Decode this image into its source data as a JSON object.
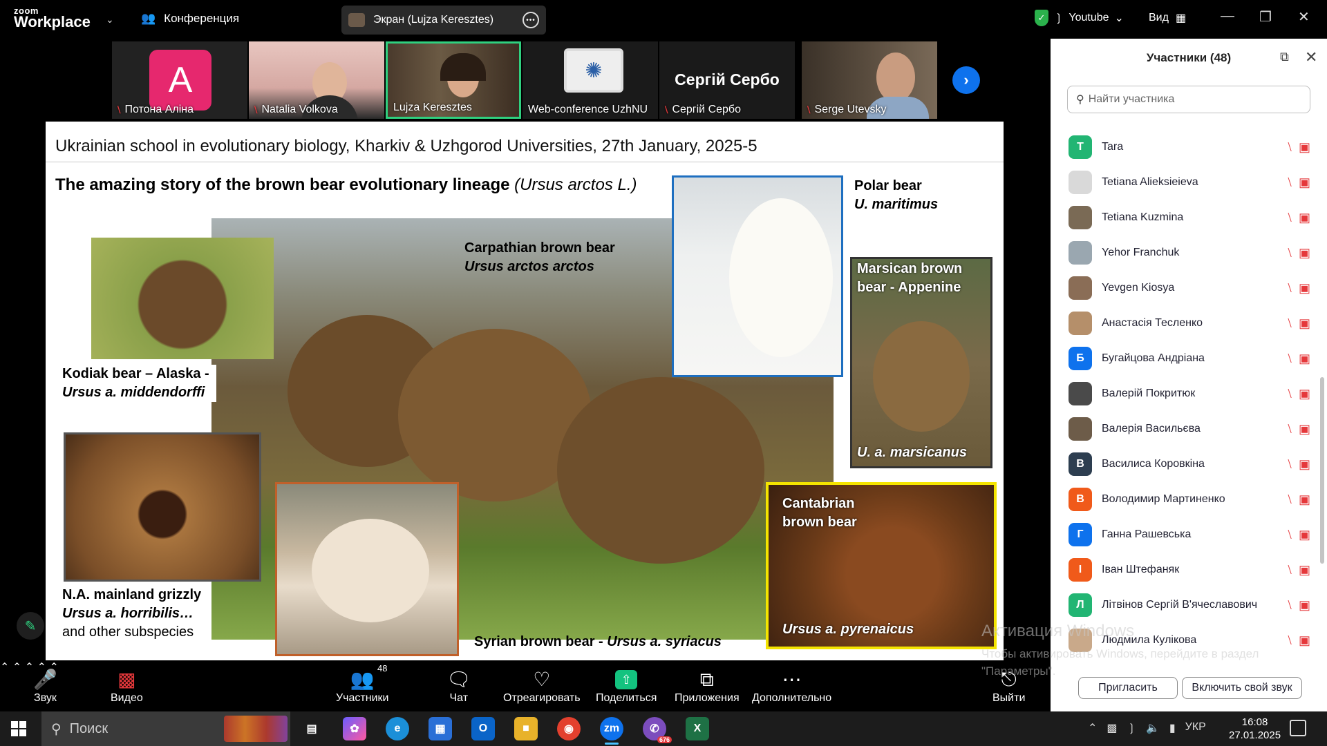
{
  "topbar": {
    "logo_line1": "zoom",
    "logo_line2": "Workplace",
    "conference_label": "Конференция",
    "screen_share_label": "Экран (Lujza Keresztes)",
    "stream_label": "Youtube",
    "view_label": "Вид"
  },
  "thumbnails": [
    {
      "name": "Потона Аліна",
      "initial": "A",
      "color": "#e6286e"
    },
    {
      "name": "Natalia Volkova"
    },
    {
      "name": "Lujza Keresztes"
    },
    {
      "name": "Web-conference UzhNU"
    },
    {
      "name": "Сергій Сербо",
      "display": "Сергій Сербо"
    },
    {
      "name": "Serge Utevsky"
    }
  ],
  "slide": {
    "header": "Ukrainian school in evolutionary biology, Kharkiv & Uzhgorod Universities, 27th January, 2025-5",
    "title_main": "The amazing story of the brown bear evolutionary lineage ",
    "title_species": "(Ursus arctos",
    "title_author": " L.)",
    "captions": {
      "kodiak_1": "Kodiak bear – Alaska -",
      "kodiak_2": "Ursus a. middendorffi",
      "carpathian_1": "Carpathian brown bear",
      "carpathian_2": "Ursus arctos arctos",
      "polar_1": "Polar bear",
      "polar_2": "U. maritimus",
      "marsican_1": "Marsican brown",
      "marsican_2": "bear - Appenine",
      "marsican_3": "U. a. marsicanus",
      "grizzly_1": "N.A. mainland grizzly",
      "grizzly_2": "Ursus a. horribilis…",
      "grizzly_3": "and other subspecies",
      "syrian_1": "Syrian brown bear - ",
      "syrian_2": "Ursus a. syriacus",
      "cantabrian_1": "Cantabrian",
      "cantabrian_2": "brown bear",
      "cantabrian_3": "Ursus a. pyrenaicus"
    }
  },
  "participants": {
    "title": "Участники (48)",
    "search_placeholder": "Найти участника",
    "list": [
      {
        "name": "Tara",
        "initial": "T",
        "color": "#22b573"
      },
      {
        "name": "Tetiana Alieksieieva",
        "initial": "",
        "color": "#d9d9d9"
      },
      {
        "name": "Tetiana Kuzmina",
        "initial": "",
        "color": "#7a6a55"
      },
      {
        "name": "Yehor Franchuk",
        "initial": "",
        "color": "#9aa7b0"
      },
      {
        "name": "Yevgen Kiosya",
        "initial": "",
        "color": "#8a6d56"
      },
      {
        "name": "Анастасія Тесленко",
        "initial": "",
        "color": "#b58f6a"
      },
      {
        "name": "Бугайцова Андріана",
        "initial": "Б",
        "color": "#0e72ed"
      },
      {
        "name": "Валерій Покритюк",
        "initial": "",
        "color": "#4a4a4a"
      },
      {
        "name": "Валерія Васильєва",
        "initial": "",
        "color": "#6d5c49"
      },
      {
        "name": "Василиса Коровкіна",
        "initial": "В",
        "color": "#2d3e50"
      },
      {
        "name": "Володимир Мартиненко",
        "initial": "В",
        "color": "#f05a1a"
      },
      {
        "name": "Ганна Рашевська",
        "initial": "Г",
        "color": "#0e72ed"
      },
      {
        "name": "Іван Штефаняк",
        "initial": "І",
        "color": "#f05a1a"
      },
      {
        "name": "Літвінов Сергій В'ячеславович",
        "initial": "Л",
        "color": "#22b573"
      },
      {
        "name": "Людмила Кулікова",
        "initial": "",
        "color": "#c9a98a"
      }
    ],
    "invite_label": "Пригласить",
    "unmute_label": "Включить свой звук"
  },
  "toolbar": {
    "audio": "Звук",
    "video": "Видео",
    "participants": "Участники",
    "participants_count": "48",
    "chat": "Чат",
    "react": "Отреагировать",
    "share": "Поделиться",
    "apps": "Приложения",
    "more": "Дополнительно",
    "leave": "Выйти"
  },
  "watermark": {
    "line1": "Активация Windows",
    "line2": "Чтобы активировать Windows, перейдите в раздел \"Параметры\"."
  },
  "taskbar": {
    "search_label": "Поиск",
    "language": "УКР",
    "time": "16:08",
    "date": "27.01.2025",
    "viber_badge": "676"
  }
}
